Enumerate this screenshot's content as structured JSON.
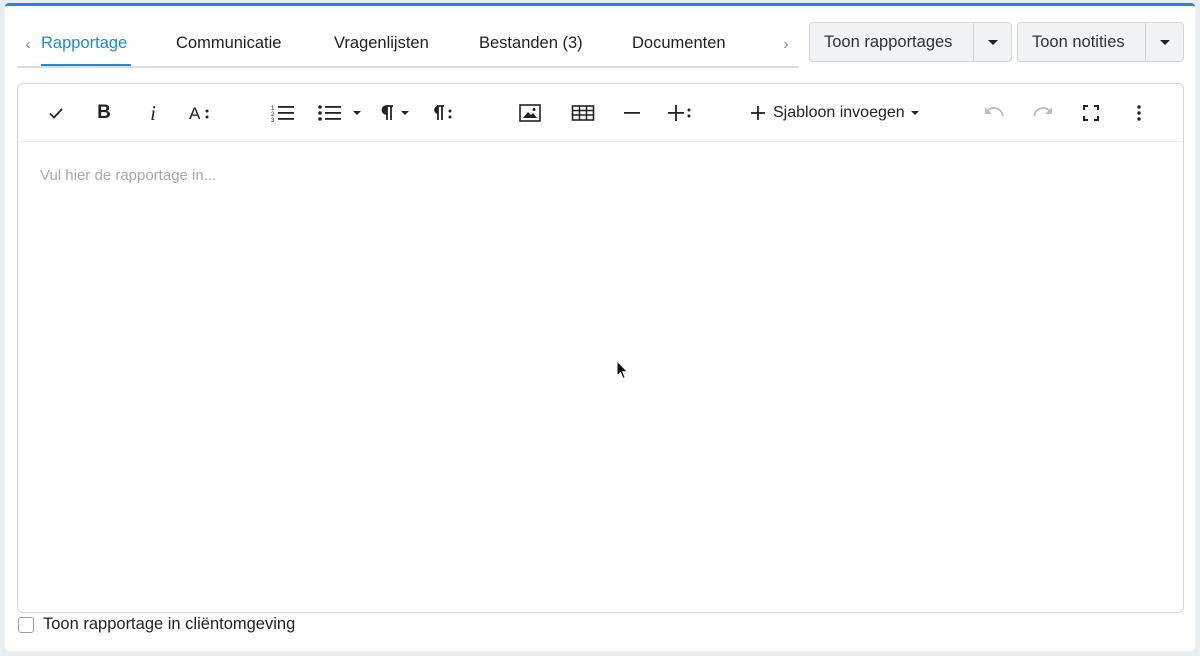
{
  "tabs": {
    "prev_arrow": "‹",
    "next_arrow": "›",
    "items": [
      {
        "label": "Rapportage",
        "active": true
      },
      {
        "label": "Communicatie",
        "active": false
      },
      {
        "label": "Vragenlijsten",
        "active": false
      },
      {
        "label": "Bestanden (3)",
        "active": false
      },
      {
        "label": "Documenten",
        "active": false
      }
    ]
  },
  "buttons": {
    "toon_rapportages": "Toon rapportages",
    "toon_notities": "Toon notities"
  },
  "toolbar": {
    "bold": "B",
    "italic": "i",
    "insert_template": "Sjabloon invoegen",
    "icons": [
      "check-icon",
      "bold-icon",
      "italic-icon",
      "font-size-icon",
      "ordered-list-icon",
      "unordered-list-icon",
      "paragraph-format-icon",
      "paragraph-style-icon",
      "image-icon",
      "table-icon",
      "horizontal-line-icon",
      "more-text-icon",
      "plus-icon",
      "undo-icon",
      "redo-icon",
      "fullscreen-icon",
      "more-vertical-icon"
    ]
  },
  "editor": {
    "placeholder": "Vul hier de rapportage in..."
  },
  "footer": {
    "checkbox_label": "Toon rapportage in cliëntomgeving",
    "checked": false
  },
  "colors": {
    "accent": "#1d8ad6",
    "background": "#e9edef"
  }
}
